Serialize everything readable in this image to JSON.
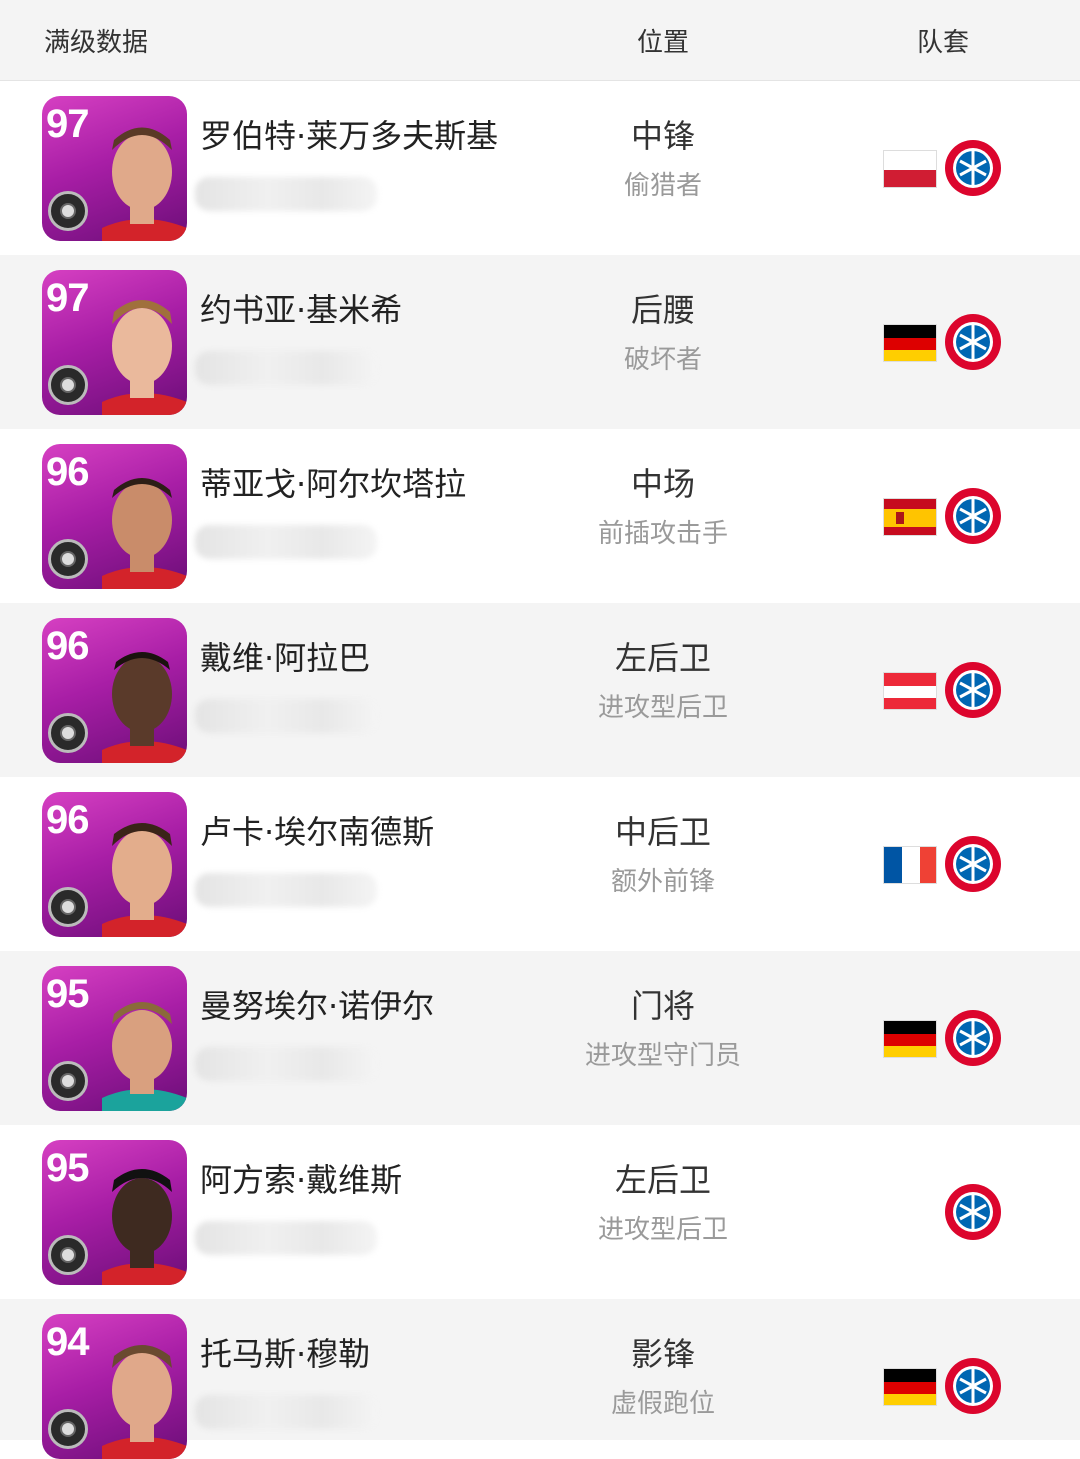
{
  "header": {
    "col_data": "满级数据",
    "col_position": "位置",
    "col_kit": "队套"
  },
  "players": [
    {
      "rating": "97",
      "name": "罗伯特·莱万多夫斯基",
      "position": "中锋",
      "style": "偷猎者",
      "flag": "poland-flag"
    },
    {
      "rating": "97",
      "name": "约书亚·基米希",
      "position": "后腰",
      "style": "破坏者",
      "flag": "germany-flag"
    },
    {
      "rating": "96",
      "name": "蒂亚戈·阿尔坎塔拉",
      "position": "中场",
      "style": "前插攻击手",
      "flag": "spain-flag"
    },
    {
      "rating": "96",
      "name": "戴维·阿拉巴",
      "position": "左后卫",
      "style": "进攻型后卫",
      "flag": "austria-flag"
    },
    {
      "rating": "96",
      "name": "卢卡·埃尔南德斯",
      "position": "中后卫",
      "style": "额外前锋",
      "flag": "france-flag"
    },
    {
      "rating": "95",
      "name": "曼努埃尔·诺伊尔",
      "position": "门将",
      "style": "进攻型守门员",
      "flag": "germany-flag"
    },
    {
      "rating": "95",
      "name": "阿方索·戴维斯",
      "position": "左后卫",
      "style": "进攻型后卫",
      "flag": ""
    },
    {
      "rating": "94",
      "name": "托马斯·穆勒",
      "position": "影锋",
      "style": "虚假跑位",
      "flag": "germany-flag"
    }
  ],
  "colors": {
    "card_purple": "#a81ea6",
    "row_alt": "#f4f4f4",
    "sub_text": "#9a9a9a"
  }
}
